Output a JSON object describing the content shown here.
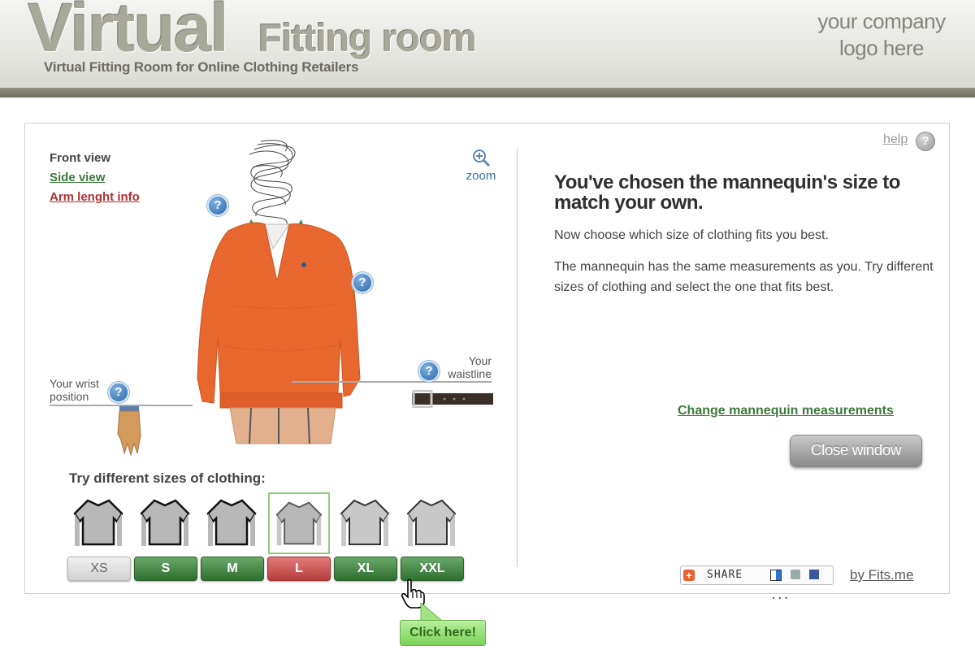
{
  "header": {
    "logo_big": "Virtual",
    "logo_small": "Fitting room",
    "tagline": "Virtual Fitting Room for Online Clothing Retailers",
    "company_logo_line1": "your company",
    "company_logo_line2": "logo here"
  },
  "view_links": {
    "front": "Front view",
    "side": "Side view",
    "arm": "Arm lenght info"
  },
  "zoom_label": "zoom",
  "hints": {
    "wrist_line1": "Your wrist",
    "wrist_line2": "position",
    "waist_line1": "Your",
    "waist_line2": "waistline"
  },
  "help_icon_glyph": "?",
  "sizes": {
    "label": "Try different sizes of clothing:",
    "options": [
      "XS",
      "S",
      "M",
      "L",
      "XL",
      "XXL"
    ],
    "selected": "L"
  },
  "right": {
    "help_link": "help",
    "title": "You've chosen the mannequin's size to match your own.",
    "paragraph1": "Now choose which size of clothing fits you best.",
    "paragraph2": "The mannequin has the same measurements as you. Try different sizes of clothing and select the one that fits best.",
    "change_link": "Change mannequin measurements",
    "close_button": "Close window",
    "share_label": "SHARE",
    "share_more": "...",
    "by_fits": "by Fits.me"
  },
  "callout": "Click here!",
  "colors": {
    "green_button": "#3a7f3a",
    "red_button": "#c24a4a",
    "link_green": "#3a7a3a",
    "link_red": "#b03030",
    "sweater": "#e8672f"
  }
}
